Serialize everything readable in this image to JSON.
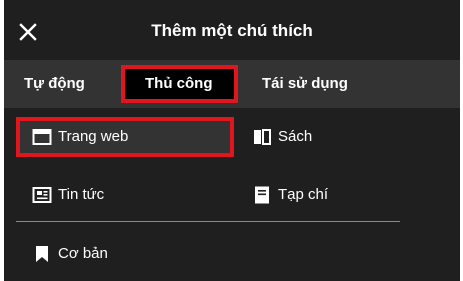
{
  "dialog": {
    "title": "Thêm một chú thích",
    "close_icon": "close-icon"
  },
  "tabs": [
    {
      "label": "Tự động",
      "active": false
    },
    {
      "label": "Thủ công",
      "active": true
    },
    {
      "label": "Tái sử dụng",
      "active": false
    }
  ],
  "source_types": [
    {
      "label": "Trang web",
      "icon": "webpage-icon",
      "selected": true
    },
    {
      "label": "Sách",
      "icon": "book-icon",
      "selected": false
    },
    {
      "label": "Tin tức",
      "icon": "news-icon",
      "selected": false
    },
    {
      "label": "Tạp chí",
      "icon": "journal-icon",
      "selected": false
    },
    {
      "label": "Cơ bản",
      "icon": "bookmark-icon",
      "selected": false
    }
  ],
  "colors": {
    "background": "#1f1f1f",
    "tab_bar": "#333333",
    "highlight": "#e0161f",
    "text": "#ffffff"
  }
}
